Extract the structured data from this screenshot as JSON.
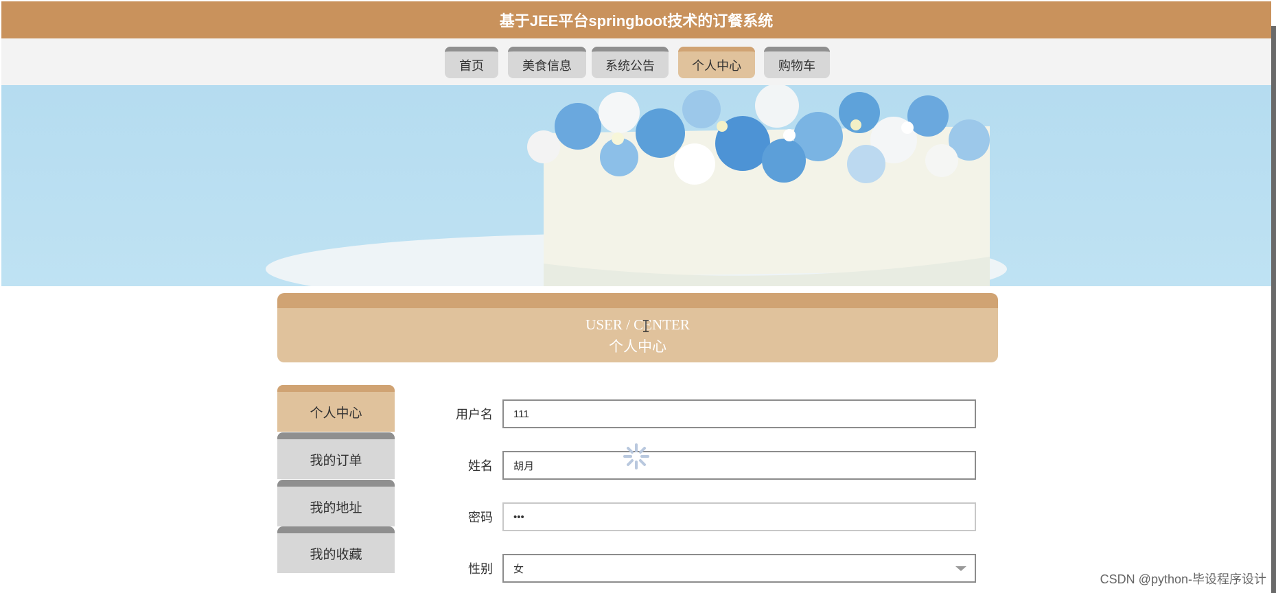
{
  "header": {
    "title": "基于JEE平台springboot技术的订餐系统"
  },
  "nav": {
    "items": [
      {
        "label": "首页"
      },
      {
        "label": "美食信息"
      },
      {
        "label": "系统公告"
      },
      {
        "label": "个人中心",
        "active": true
      },
      {
        "label": "购物车"
      }
    ]
  },
  "section": {
    "title_en": "USER / CENTER",
    "title_cn": "个人中心"
  },
  "sidebar": {
    "items": [
      {
        "label": "个人中心",
        "active": true
      },
      {
        "label": "我的订单"
      },
      {
        "label": "我的地址"
      },
      {
        "label": "我的收藏"
      }
    ]
  },
  "form": {
    "username": {
      "label": "用户名",
      "value": "111"
    },
    "name": {
      "label": "姓名",
      "value": "胡月"
    },
    "password": {
      "label": "密码",
      "value": "***"
    },
    "gender": {
      "label": "性别",
      "value": "女"
    }
  },
  "watermark": "CSDN @python-毕设程序设计",
  "colors": {
    "header": "#c9925c",
    "active_tab": "#e0c29c",
    "inactive_tab": "#d7d7d7",
    "banner_sky": "#b5dcf0"
  },
  "icons": {
    "loading": "loading-spinner-icon",
    "select_caret": "chevron-down-icon"
  }
}
